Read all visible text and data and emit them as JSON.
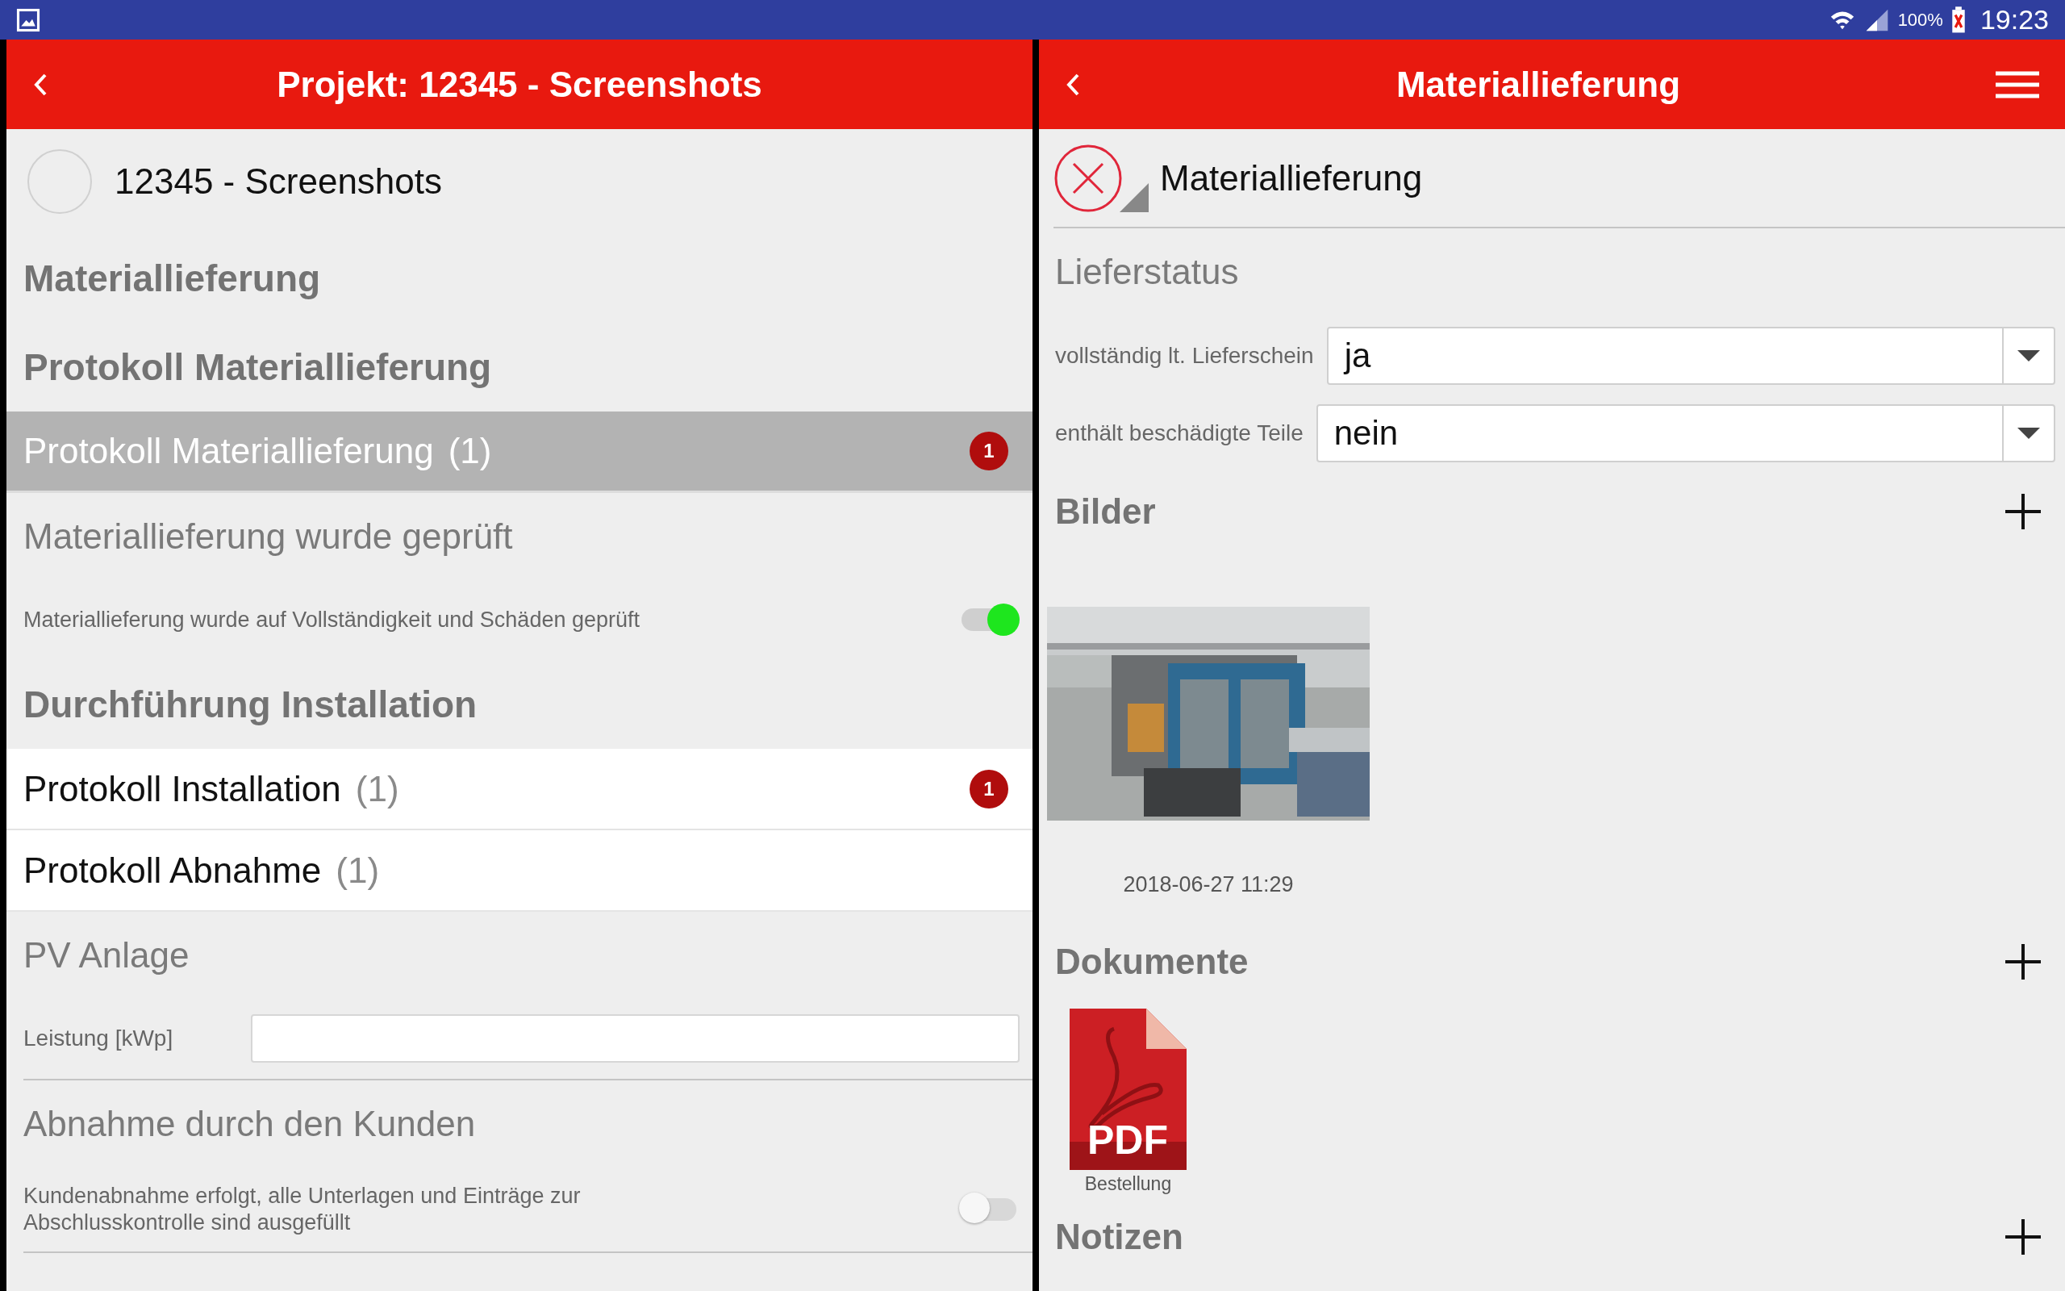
{
  "status_bar": {
    "battery": "100%",
    "time": "19:23"
  },
  "left_panel": {
    "title": "Projekt: 12345 - Screenshots",
    "project": "12345 - Screenshots",
    "items": [
      {
        "kind": "heading",
        "text": "Materiallieferung"
      },
      {
        "kind": "heading",
        "text": "Protokoll Materiallieferung"
      },
      {
        "kind": "protocol",
        "label": "Protokoll Materiallieferung",
        "count": "(1)",
        "badge": "1",
        "selected": true
      },
      {
        "kind": "subheading",
        "text": "Materiallieferung wurde geprüft"
      },
      {
        "kind": "toggle",
        "label": "Materiallieferung wurde auf Vollständigkeit und Schäden geprüft",
        "on": true
      },
      {
        "kind": "heading",
        "text": "Durchführung Installation"
      },
      {
        "kind": "protocol",
        "label": "Protokoll Installation",
        "count": "(1)",
        "badge": "1",
        "selected": false
      },
      {
        "kind": "protocol",
        "label": "Protokoll Abnahme",
        "count": "(1)",
        "selected": false
      },
      {
        "kind": "subheading",
        "text": "PV Anlage"
      },
      {
        "kind": "input",
        "label": "Leistung [kWp]"
      },
      {
        "kind": "subheading",
        "text": "Abnahme durch den Kunden"
      },
      {
        "kind": "toggle",
        "label": "Kundenabnahme erfolgt, alle Unterlagen und Einträge zur Abschlusskontrolle sind ausgefüllt",
        "on": false
      }
    ]
  },
  "right_panel": {
    "title": "Materiallieferung",
    "form_title": "Materiallieferung",
    "section": "Lieferstatus",
    "dropdowns": [
      {
        "label": "vollständig lt. Lieferschein",
        "value": "ja"
      },
      {
        "label": "enthält beschädigte Teile",
        "value": "nein"
      }
    ],
    "images": {
      "title": "Bilder",
      "items": [
        {
          "kind": "picture",
          "date": "2018-06-27 11:29"
        }
      ]
    },
    "documents": {
      "title": "Dokumente",
      "items": [
        {
          "badge": "PDF",
          "name": "Bestellung"
        }
      ]
    },
    "notes": {
      "title": "Notizen"
    }
  }
}
